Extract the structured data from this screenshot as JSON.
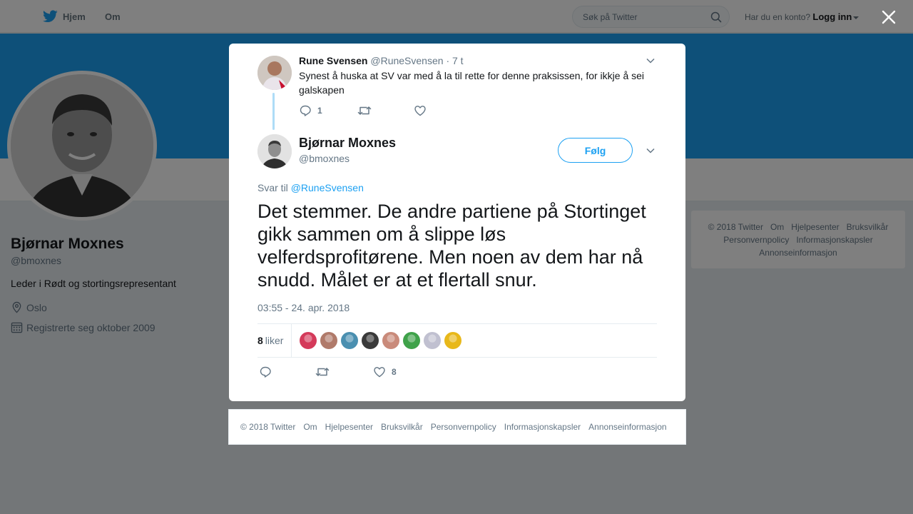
{
  "topbar": {
    "home_label": "Hjem",
    "about_label": "Om",
    "search_placeholder": "Søk på Twitter",
    "login_prompt": "Har du en konto?",
    "login_label": "Logg inn"
  },
  "profile": {
    "name": "Bjørnar Moxnes",
    "handle": "@bmoxnes",
    "bio": "Leder i Rødt og stortingsrepresentant",
    "location": "Oslo",
    "joined": "Registrerte seg oktober 2009"
  },
  "side_footer": {
    "links": [
      "© 2018 Twitter",
      "Om",
      "Hjelpesenter",
      "Bruksvilkår",
      "Personvernpolicy",
      "Informasjonskapsler",
      "Annonseinformasjon"
    ]
  },
  "context_tweet": {
    "name": "Rune Svensen",
    "handle": "@RuneSvensen",
    "time": "· 7 t",
    "text": "Synest å huska at SV var med å la til rette for denne praksissen, for ikkje å sei galskapen",
    "reply_count": "1"
  },
  "main_tweet": {
    "name": "Bjørnar Moxnes",
    "handle": "@bmoxnes",
    "follow_label": "Følg",
    "reply_prefix": "Svar til",
    "reply_to": "@RuneSvensen",
    "text": "Det stemmer. De andre partiene på Stortinget gikk sammen om å slippe løs velferdsprofitørene. Men noen av dem har nå snudd. Målet er at et flertall snur.",
    "timestamp": "03:55 - 24. apr. 2018",
    "likes_number": "8",
    "likes_label": "liker",
    "like_count": "8"
  },
  "likers": [
    {
      "color": "#d43a5a"
    },
    {
      "color": "#b07a6a"
    },
    {
      "color": "#4a8fb0"
    },
    {
      "color": "#3a3a3a"
    },
    {
      "color": "#c98a7a"
    },
    {
      "color": "#3fa24a"
    },
    {
      "color": "#c0c0d0"
    },
    {
      "color": "#e8b81a"
    }
  ],
  "bottom_footer": {
    "links": [
      "© 2018 Twitter",
      "Om",
      "Hjelpesenter",
      "Bruksvilkår",
      "Personvernpolicy",
      "Informasjonskapsler",
      "Annonseinformasjon"
    ]
  },
  "colors": {
    "brand": "#1da1f2",
    "muted": "#657786"
  }
}
